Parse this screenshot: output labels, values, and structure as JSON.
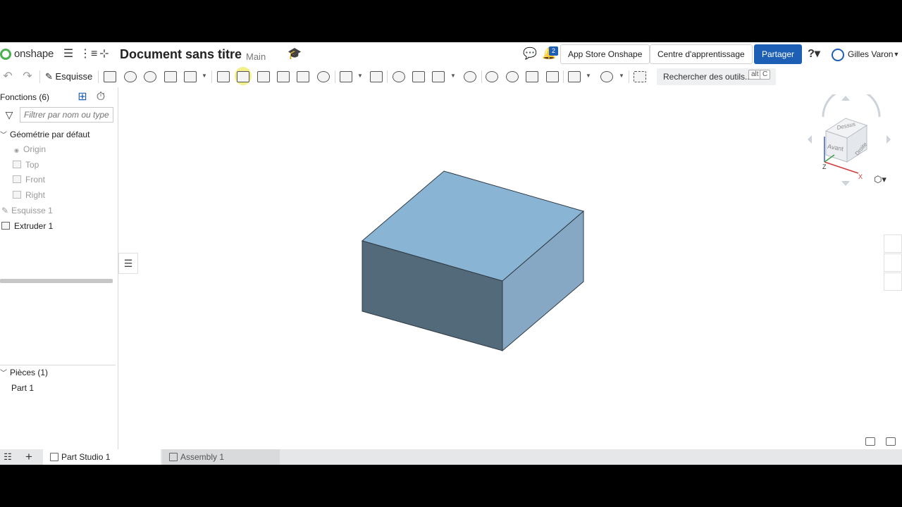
{
  "header": {
    "brand": "onshape",
    "doc_title": "Document sans titre",
    "branch": "Main",
    "notification_count": "2",
    "app_store": "App Store Onshape",
    "learning_center": "Centre d'apprentissage",
    "share": "Partager",
    "help": "?",
    "user": "Gilles Varon"
  },
  "toolbar": {
    "sketch_label": "Esquisse",
    "search_placeholder": "Rechercher des outils...",
    "shortcut_1": "alt",
    "shortcut_2": "C"
  },
  "feature_panel": {
    "title": "Fonctions (6)",
    "filter_placeholder": "Filtrer par nom ou type",
    "default_geometry": "Géométrie par défaut",
    "items": [
      "Origin",
      "Top",
      "Front",
      "Right",
      "Esquisse 1",
      "Extruder 1"
    ],
    "parts_header": "Pièces (1)",
    "parts": [
      "Part 1"
    ]
  },
  "viewcube": {
    "top": "Dessus",
    "front": "Avant",
    "right": "Droite",
    "axis_z": "Z",
    "axis_x": "X"
  },
  "tabs": [
    "Part Studio 1",
    "Assembly 1"
  ],
  "colors": {
    "accent": "#1d5fb4",
    "part_top": "#8ab4d3",
    "part_front": "#536a7a",
    "part_right": "#86a8c4"
  }
}
